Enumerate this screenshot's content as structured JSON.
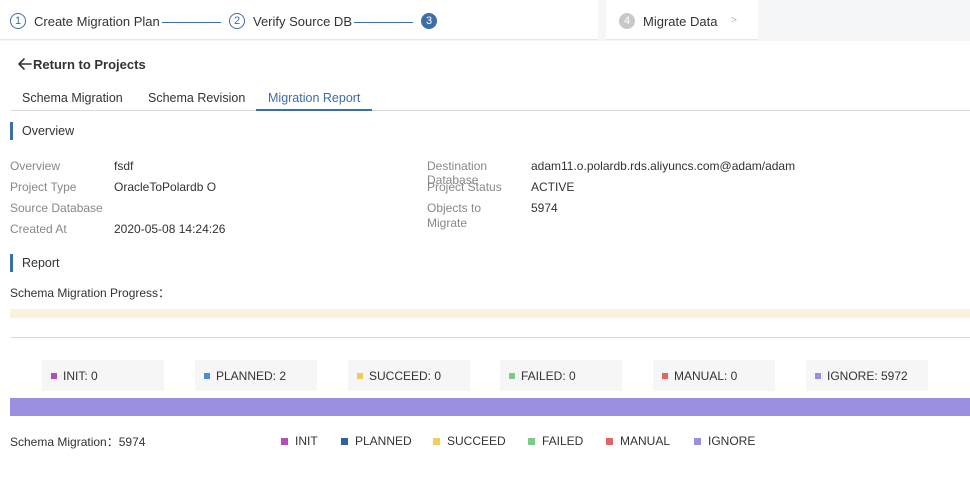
{
  "stepper": {
    "steps": [
      {
        "number": "1",
        "label": "Create Migration Plan"
      },
      {
        "number": "2",
        "label": "Verify Source DB"
      },
      {
        "number": "3",
        "label": ""
      },
      {
        "number": "4",
        "label": "Migrate Data"
      }
    ],
    "next_arrow": ">"
  },
  "back": {
    "label": "Return to Projects"
  },
  "tabs": [
    {
      "label": "Schema Migration"
    },
    {
      "label": "Schema Revision"
    },
    {
      "label": "Migration Report"
    }
  ],
  "overview": {
    "title": "Overview",
    "fields": [
      {
        "label": "Overview",
        "value": "fsdf"
      },
      {
        "label": "Project Type",
        "value": "OracleToPolardb O"
      },
      {
        "label": "Source Database",
        "value": ""
      },
      {
        "label": "Created At",
        "value": "2020-05-08 14:24:26"
      },
      {
        "label": "Destination Database",
        "value": "adam11.o.polardb.rds.aliyuncs.com@adam/adam"
      },
      {
        "label": "Project Status",
        "value": "ACTIVE"
      },
      {
        "label": "Objects to Migrate",
        "value": "5974"
      }
    ]
  },
  "report": {
    "title": "Report",
    "progress_label": "Schema Migration Progress：",
    "total_label": "Schema Migration：",
    "total_value": "5974",
    "status_chips": [
      {
        "label": "INIT: 0",
        "color": "#b44fb8"
      },
      {
        "label": "PLANNED: 2",
        "color": "#4a8fd6"
      },
      {
        "label": "SUCCEED: 0",
        "color": "#f2cd5c"
      },
      {
        "label": "FAILED: 0",
        "color": "#7fc98a"
      },
      {
        "label": "MANUAL: 0",
        "color": "#e06666"
      },
      {
        "label": "IGNORE: 5972",
        "color": "#9b8fe0"
      }
    ],
    "legend": [
      {
        "label": "INIT",
        "color": "#b44fb8"
      },
      {
        "label": "PLANNED",
        "color": "#2f5fa8"
      },
      {
        "label": "SUCCEED",
        "color": "#f2cd5c"
      },
      {
        "label": "FAILED",
        "color": "#7fc98a"
      },
      {
        "label": "MANUAL",
        "color": "#e06666"
      },
      {
        "label": "IGNORE",
        "color": "#9b8fe0"
      }
    ],
    "bar": {
      "total": 5974,
      "segments": [
        {
          "status": "INIT",
          "count": 0,
          "color": "#b44fb8"
        },
        {
          "status": "PLANNED",
          "count": 2,
          "color": "#2f5fa8"
        },
        {
          "status": "SUCCEED",
          "count": 0,
          "color": "#f2cd5c"
        },
        {
          "status": "FAILED",
          "count": 0,
          "color": "#7fc98a"
        },
        {
          "status": "MANUAL",
          "count": 0,
          "color": "#e06666"
        },
        {
          "status": "IGNORE",
          "count": 5972,
          "color": "#9b8fe0"
        }
      ]
    }
  },
  "colors": {
    "accent": "#3c6ea7",
    "progress_track": "#fbf2dd"
  }
}
